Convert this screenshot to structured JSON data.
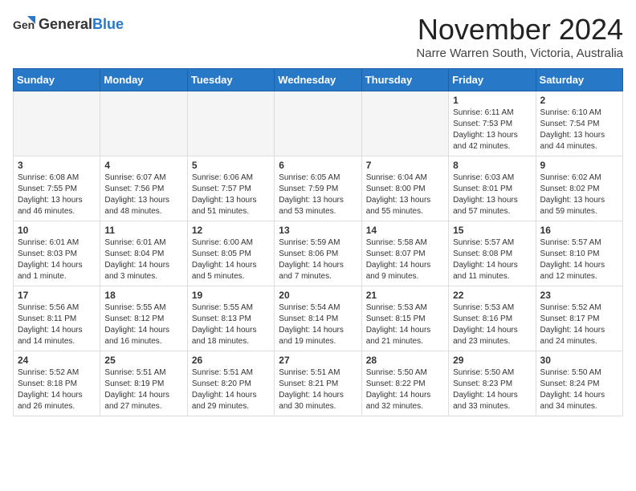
{
  "header": {
    "logo_general": "General",
    "logo_blue": "Blue",
    "month": "November 2024",
    "location": "Narre Warren South, Victoria, Australia"
  },
  "calendar": {
    "days_of_week": [
      "Sunday",
      "Monday",
      "Tuesday",
      "Wednesday",
      "Thursday",
      "Friday",
      "Saturday"
    ],
    "weeks": [
      [
        {
          "day": "",
          "info": ""
        },
        {
          "day": "",
          "info": ""
        },
        {
          "day": "",
          "info": ""
        },
        {
          "day": "",
          "info": ""
        },
        {
          "day": "",
          "info": ""
        },
        {
          "day": "1",
          "info": "Sunrise: 6:11 AM\nSunset: 7:53 PM\nDaylight: 13 hours\nand 42 minutes."
        },
        {
          "day": "2",
          "info": "Sunrise: 6:10 AM\nSunset: 7:54 PM\nDaylight: 13 hours\nand 44 minutes."
        }
      ],
      [
        {
          "day": "3",
          "info": "Sunrise: 6:08 AM\nSunset: 7:55 PM\nDaylight: 13 hours\nand 46 minutes."
        },
        {
          "day": "4",
          "info": "Sunrise: 6:07 AM\nSunset: 7:56 PM\nDaylight: 13 hours\nand 48 minutes."
        },
        {
          "day": "5",
          "info": "Sunrise: 6:06 AM\nSunset: 7:57 PM\nDaylight: 13 hours\nand 51 minutes."
        },
        {
          "day": "6",
          "info": "Sunrise: 6:05 AM\nSunset: 7:59 PM\nDaylight: 13 hours\nand 53 minutes."
        },
        {
          "day": "7",
          "info": "Sunrise: 6:04 AM\nSunset: 8:00 PM\nDaylight: 13 hours\nand 55 minutes."
        },
        {
          "day": "8",
          "info": "Sunrise: 6:03 AM\nSunset: 8:01 PM\nDaylight: 13 hours\nand 57 minutes."
        },
        {
          "day": "9",
          "info": "Sunrise: 6:02 AM\nSunset: 8:02 PM\nDaylight: 13 hours\nand 59 minutes."
        }
      ],
      [
        {
          "day": "10",
          "info": "Sunrise: 6:01 AM\nSunset: 8:03 PM\nDaylight: 14 hours\nand 1 minute."
        },
        {
          "day": "11",
          "info": "Sunrise: 6:01 AM\nSunset: 8:04 PM\nDaylight: 14 hours\nand 3 minutes."
        },
        {
          "day": "12",
          "info": "Sunrise: 6:00 AM\nSunset: 8:05 PM\nDaylight: 14 hours\nand 5 minutes."
        },
        {
          "day": "13",
          "info": "Sunrise: 5:59 AM\nSunset: 8:06 PM\nDaylight: 14 hours\nand 7 minutes."
        },
        {
          "day": "14",
          "info": "Sunrise: 5:58 AM\nSunset: 8:07 PM\nDaylight: 14 hours\nand 9 minutes."
        },
        {
          "day": "15",
          "info": "Sunrise: 5:57 AM\nSunset: 8:08 PM\nDaylight: 14 hours\nand 11 minutes."
        },
        {
          "day": "16",
          "info": "Sunrise: 5:57 AM\nSunset: 8:10 PM\nDaylight: 14 hours\nand 12 minutes."
        }
      ],
      [
        {
          "day": "17",
          "info": "Sunrise: 5:56 AM\nSunset: 8:11 PM\nDaylight: 14 hours\nand 14 minutes."
        },
        {
          "day": "18",
          "info": "Sunrise: 5:55 AM\nSunset: 8:12 PM\nDaylight: 14 hours\nand 16 minutes."
        },
        {
          "day": "19",
          "info": "Sunrise: 5:55 AM\nSunset: 8:13 PM\nDaylight: 14 hours\nand 18 minutes."
        },
        {
          "day": "20",
          "info": "Sunrise: 5:54 AM\nSunset: 8:14 PM\nDaylight: 14 hours\nand 19 minutes."
        },
        {
          "day": "21",
          "info": "Sunrise: 5:53 AM\nSunset: 8:15 PM\nDaylight: 14 hours\nand 21 minutes."
        },
        {
          "day": "22",
          "info": "Sunrise: 5:53 AM\nSunset: 8:16 PM\nDaylight: 14 hours\nand 23 minutes."
        },
        {
          "day": "23",
          "info": "Sunrise: 5:52 AM\nSunset: 8:17 PM\nDaylight: 14 hours\nand 24 minutes."
        }
      ],
      [
        {
          "day": "24",
          "info": "Sunrise: 5:52 AM\nSunset: 8:18 PM\nDaylight: 14 hours\nand 26 minutes."
        },
        {
          "day": "25",
          "info": "Sunrise: 5:51 AM\nSunset: 8:19 PM\nDaylight: 14 hours\nand 27 minutes."
        },
        {
          "day": "26",
          "info": "Sunrise: 5:51 AM\nSunset: 8:20 PM\nDaylight: 14 hours\nand 29 minutes."
        },
        {
          "day": "27",
          "info": "Sunrise: 5:51 AM\nSunset: 8:21 PM\nDaylight: 14 hours\nand 30 minutes."
        },
        {
          "day": "28",
          "info": "Sunrise: 5:50 AM\nSunset: 8:22 PM\nDaylight: 14 hours\nand 32 minutes."
        },
        {
          "day": "29",
          "info": "Sunrise: 5:50 AM\nSunset: 8:23 PM\nDaylight: 14 hours\nand 33 minutes."
        },
        {
          "day": "30",
          "info": "Sunrise: 5:50 AM\nSunset: 8:24 PM\nDaylight: 14 hours\nand 34 minutes."
        }
      ]
    ]
  }
}
